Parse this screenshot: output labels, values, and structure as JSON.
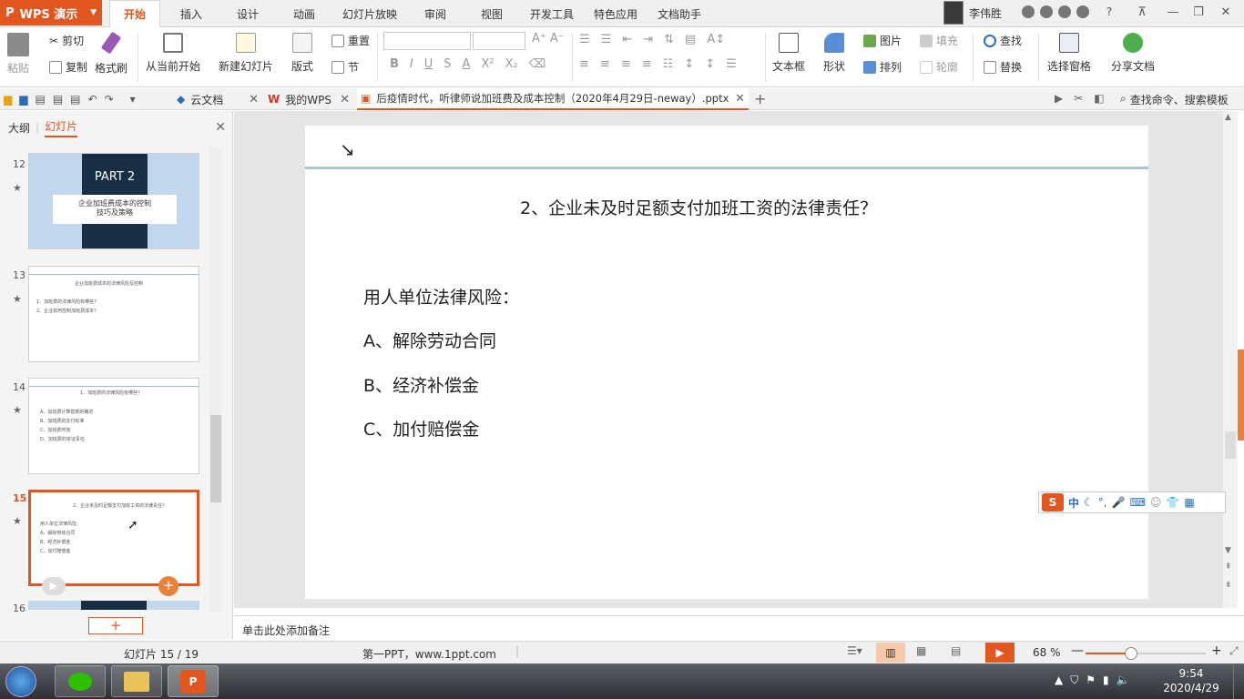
{
  "app": {
    "logo": "WPS 演示",
    "brand_color": "#e2561f"
  },
  "menu_tabs": [
    "开始",
    "插入",
    "设计",
    "动画",
    "幻灯片放映",
    "审阅",
    "视图",
    "开发工具",
    "特色应用",
    "文档助手"
  ],
  "user": {
    "name": "李伟胜"
  },
  "ribbon": {
    "paste": "粘贴",
    "cut": "剪切",
    "copy": "复制",
    "format_painter": "格式刷",
    "from_current": "从当前开始",
    "new_slide": "新建幻灯片",
    "layout": "版式",
    "reset": "重置",
    "section": "节",
    "textbox": "文本框",
    "shape": "形状",
    "picture": "图片",
    "fill": "填充",
    "arrange": "排列",
    "outline": "轮廓",
    "find": "查找",
    "replace": "替换",
    "selection_pane": "选择窗格",
    "share": "分享文档"
  },
  "doc_tabs": {
    "cloud": "云文档",
    "mywps": "我的WPS",
    "active": "后疫情时代，听律师说加班费及成本控制（2020年4月29日-neway）.pptx",
    "search": "查找命令、搜索模板"
  },
  "left_panel": {
    "outline_tab": "大纲",
    "slides_tab": "幻灯片"
  },
  "thumbnails": [
    {
      "num": "12",
      "title": "PART 2",
      "sub1": "企业加班费成本的控制",
      "sub2": "技巧及策略"
    },
    {
      "num": "13",
      "heading": "企业加班费成本的法律风险及控制",
      "l1": "1、加班费的法律风险有哪些？",
      "l2": "2、企业如何控制加班费成本？"
    },
    {
      "num": "14",
      "heading": "1、加班费的法律风险有哪些？",
      "l1": "A、加班费计算基数的确定",
      "l2": "B、加班费的支付标准",
      "l3": "C、加班费时效",
      "l4": "D、加班费的举证责任"
    },
    {
      "num": "15",
      "heading": "2、企业未及时足额支付加班工资的法律责任？",
      "l1": "用人单位法律风险：",
      "l2": "A、解除劳动合同",
      "l3": "B、经济补偿金",
      "l4": "C、加付赔偿金"
    },
    {
      "num": "16"
    }
  ],
  "slide": {
    "title": "2、企业未及时足额支付加班工资的法律责任？",
    "intro": "用人单位法律风险：",
    "items": [
      "A、解除劳动合同",
      "B、经济补偿金",
      "C、加付赔偿金"
    ]
  },
  "notes_placeholder": "单击此处添加备注",
  "status": {
    "slide_count": "幻灯片 15 / 19",
    "theme": "第一PPT，www.1ppt.com",
    "zoom": "68 %",
    "zoom_fraction": 0.38
  },
  "taskbar": {
    "time": "9:54",
    "date": "2020/4/29"
  },
  "ime": {
    "mode": "中"
  }
}
